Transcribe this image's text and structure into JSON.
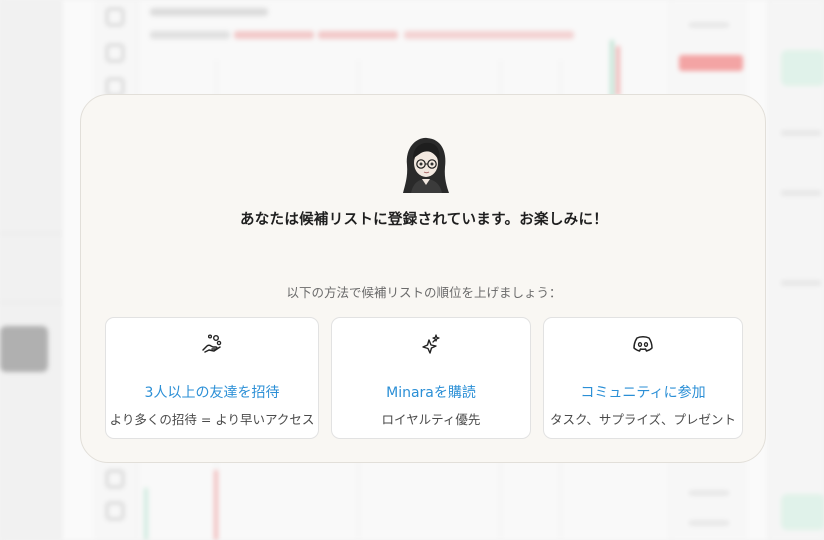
{
  "modal": {
    "title": "あなたは候補リストに登録されています。お楽しみに！",
    "subtitle": "以下の方法で候補リストの順位を上げましょう：",
    "avatar_icon": "avatar-girl-glasses",
    "cards": [
      {
        "icon": "hand-coins-icon",
        "title": "3人以上の友達を招待",
        "description": "より多くの招待 = より早いアクセス"
      },
      {
        "icon": "sparkle-stars-icon",
        "title": "Minaraを購読",
        "description": "ロイヤルティ優先"
      },
      {
        "icon": "discord-icon",
        "title": "コミュニティに参加",
        "description": "タスク、サプライズ、プレゼント"
      }
    ]
  },
  "colors": {
    "modal_bg": "#f9f7f3",
    "link_blue": "#2b8fd6",
    "title_text": "#1f1f1f",
    "sub_text": "#6b6b6b"
  }
}
